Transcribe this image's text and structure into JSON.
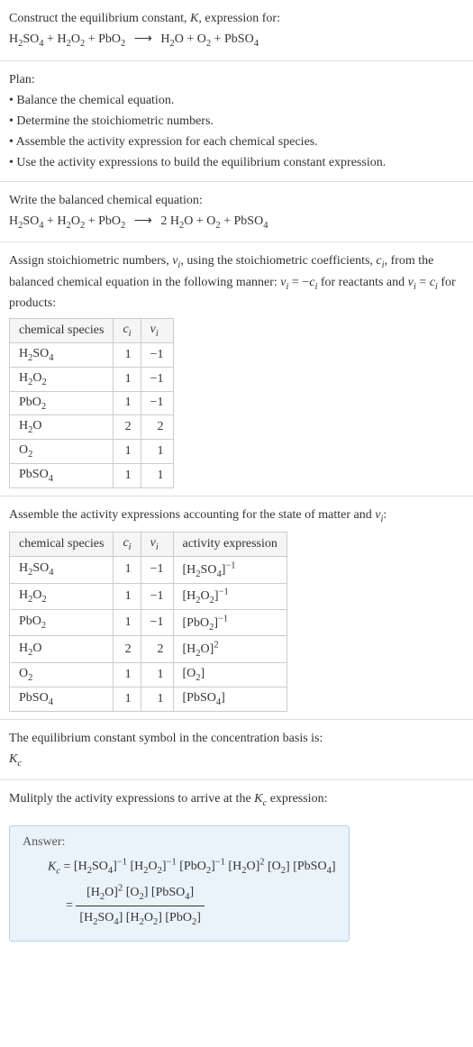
{
  "intro": {
    "line1_pre": "Construct the equilibrium constant, ",
    "line1_K": "K",
    "line1_post": ", expression for:",
    "eq_lhs": [
      {
        "base": "H",
        "sub": "2"
      },
      {
        "base": "SO",
        "sub": "4"
      },
      {
        "plus": " + "
      },
      {
        "base": "H",
        "sub": "2"
      },
      {
        "base": "O",
        "sub": "2"
      },
      {
        "plus": " + "
      },
      {
        "base": "PbO",
        "sub": "2"
      }
    ],
    "arrow": "⟶",
    "eq_rhs": [
      {
        "base": "H",
        "sub": "2"
      },
      {
        "base": "O"
      },
      {
        "plus": " + "
      },
      {
        "base": "O",
        "sub": "2"
      },
      {
        "plus": " + "
      },
      {
        "base": "PbSO",
        "sub": "4"
      }
    ]
  },
  "plan": {
    "heading": "Plan:",
    "b1": "• Balance the chemical equation.",
    "b2": "• Determine the stoichiometric numbers.",
    "b3": "• Assemble the activity expression for each chemical species.",
    "b4": "• Use the activity expressions to build the equilibrium constant expression."
  },
  "balanced": {
    "heading": "Write the balanced chemical equation:",
    "eq_lhs": [
      {
        "base": "H",
        "sub": "2"
      },
      {
        "base": "SO",
        "sub": "4"
      },
      {
        "plus": " + "
      },
      {
        "base": "H",
        "sub": "2"
      },
      {
        "base": "O",
        "sub": "2"
      },
      {
        "plus": " + "
      },
      {
        "base": "PbO",
        "sub": "2"
      }
    ],
    "arrow": "⟶",
    "eq_rhs": [
      {
        "coef": "2 "
      },
      {
        "base": "H",
        "sub": "2"
      },
      {
        "base": "O"
      },
      {
        "plus": " + "
      },
      {
        "base": "O",
        "sub": "2"
      },
      {
        "plus": " + "
      },
      {
        "base": "PbSO",
        "sub": "4"
      }
    ]
  },
  "assign": {
    "text_pre": "Assign stoichiometric numbers, ",
    "nu_i": "ν",
    "nu_i_sub": "i",
    "text_mid1": ", using the stoichiometric coefficients, ",
    "c_i": "c",
    "c_i_sub": "i",
    "text_mid2": ", from the balanced chemical equation in the following manner: ",
    "rule_react_lhs_nu": "ν",
    "rule_react_lhs_sub": "i",
    "rule_react_eq": " = −",
    "rule_react_rhs_c": "c",
    "rule_react_rhs_sub": "i",
    "text_mid3": " for reactants and ",
    "rule_prod_lhs_nu": "ν",
    "rule_prod_lhs_sub": "i",
    "rule_prod_eq": " = ",
    "rule_prod_rhs_c": "c",
    "rule_prod_rhs_sub": "i",
    "text_end": " for products:"
  },
  "table1": {
    "h1": "chemical species",
    "h2_c": "c",
    "h2_sub": "i",
    "h3_nu": "ν",
    "h3_sub": "i",
    "rows": [
      {
        "sp": [
          {
            "base": "H",
            "sub": "2"
          },
          {
            "base": "SO",
            "sub": "4"
          }
        ],
        "c": "1",
        "nu": "−1"
      },
      {
        "sp": [
          {
            "base": "H",
            "sub": "2"
          },
          {
            "base": "O",
            "sub": "2"
          }
        ],
        "c": "1",
        "nu": "−1"
      },
      {
        "sp": [
          {
            "base": "PbO",
            "sub": "2"
          }
        ],
        "c": "1",
        "nu": "−1"
      },
      {
        "sp": [
          {
            "base": "H",
            "sub": "2"
          },
          {
            "base": "O"
          }
        ],
        "c": "2",
        "nu": "2"
      },
      {
        "sp": [
          {
            "base": "O",
            "sub": "2"
          }
        ],
        "c": "1",
        "nu": "1"
      },
      {
        "sp": [
          {
            "base": "PbSO",
            "sub": "4"
          }
        ],
        "c": "1",
        "nu": "1"
      }
    ]
  },
  "activity_heading_pre": "Assemble the activity expressions accounting for the state of matter and ",
  "activity_heading_nu": "ν",
  "activity_heading_sub": "i",
  "activity_heading_post": ":",
  "table2": {
    "h1": "chemical species",
    "h2_c": "c",
    "h2_sub": "i",
    "h3_nu": "ν",
    "h3_sub": "i",
    "h4": "activity expression",
    "rows": [
      {
        "sp": [
          {
            "base": "H",
            "sub": "2"
          },
          {
            "base": "SO",
            "sub": "4"
          }
        ],
        "c": "1",
        "nu": "−1",
        "act": {
          "inner": [
            {
              "base": "H",
              "sub": "2"
            },
            {
              "base": "SO",
              "sub": "4"
            }
          ],
          "exp": "−1"
        }
      },
      {
        "sp": [
          {
            "base": "H",
            "sub": "2"
          },
          {
            "base": "O",
            "sub": "2"
          }
        ],
        "c": "1",
        "nu": "−1",
        "act": {
          "inner": [
            {
              "base": "H",
              "sub": "2"
            },
            {
              "base": "O",
              "sub": "2"
            }
          ],
          "exp": "−1"
        }
      },
      {
        "sp": [
          {
            "base": "PbO",
            "sub": "2"
          }
        ],
        "c": "1",
        "nu": "−1",
        "act": {
          "inner": [
            {
              "base": "PbO",
              "sub": "2"
            }
          ],
          "exp": "−1"
        }
      },
      {
        "sp": [
          {
            "base": "H",
            "sub": "2"
          },
          {
            "base": "O"
          }
        ],
        "c": "2",
        "nu": "2",
        "act": {
          "inner": [
            {
              "base": "H",
              "sub": "2"
            },
            {
              "base": "O"
            }
          ],
          "exp": "2"
        }
      },
      {
        "sp": [
          {
            "base": "O",
            "sub": "2"
          }
        ],
        "c": "1",
        "nu": "1",
        "act": {
          "inner": [
            {
              "base": "O",
              "sub": "2"
            }
          ],
          "exp": ""
        }
      },
      {
        "sp": [
          {
            "base": "PbSO",
            "sub": "4"
          }
        ],
        "c": "1",
        "nu": "1",
        "act": {
          "inner": [
            {
              "base": "PbSO",
              "sub": "4"
            }
          ],
          "exp": ""
        }
      }
    ]
  },
  "basis": {
    "line1": "The equilibrium constant symbol in the concentration basis is:",
    "K": "K",
    "K_sub": "c"
  },
  "mult": {
    "line_pre": "Mulitply the activity expressions to arrive at the ",
    "K": "K",
    "K_sub": "c",
    "line_post": " expression:"
  },
  "answer": {
    "label": "Answer:",
    "Kc_K": "K",
    "Kc_sub": "c",
    "eq": " = ",
    "line1_terms": [
      {
        "inner": [
          {
            "base": "H",
            "sub": "2"
          },
          {
            "base": "SO",
            "sub": "4"
          }
        ],
        "exp": "−1"
      },
      {
        "inner": [
          {
            "base": "H",
            "sub": "2"
          },
          {
            "base": "O",
            "sub": "2"
          }
        ],
        "exp": "−1"
      },
      {
        "inner": [
          {
            "base": "PbO",
            "sub": "2"
          }
        ],
        "exp": "−1"
      },
      {
        "inner": [
          {
            "base": "H",
            "sub": "2"
          },
          {
            "base": "O"
          }
        ],
        "exp": "2"
      },
      {
        "inner": [
          {
            "base": "O",
            "sub": "2"
          }
        ],
        "exp": ""
      },
      {
        "inner": [
          {
            "base": "PbSO",
            "sub": "4"
          }
        ],
        "exp": ""
      }
    ],
    "eq2_prefix": "= ",
    "frac_num": [
      {
        "inner": [
          {
            "base": "H",
            "sub": "2"
          },
          {
            "base": "O"
          }
        ],
        "exp": "2"
      },
      {
        "inner": [
          {
            "base": "O",
            "sub": "2"
          }
        ],
        "exp": ""
      },
      {
        "inner": [
          {
            "base": "PbSO",
            "sub": "4"
          }
        ],
        "exp": ""
      }
    ],
    "frac_den": [
      {
        "inner": [
          {
            "base": "H",
            "sub": "2"
          },
          {
            "base": "SO",
            "sub": "4"
          }
        ],
        "exp": ""
      },
      {
        "inner": [
          {
            "base": "H",
            "sub": "2"
          },
          {
            "base": "O",
            "sub": "2"
          }
        ],
        "exp": ""
      },
      {
        "inner": [
          {
            "base": "PbO",
            "sub": "2"
          }
        ],
        "exp": ""
      }
    ]
  }
}
